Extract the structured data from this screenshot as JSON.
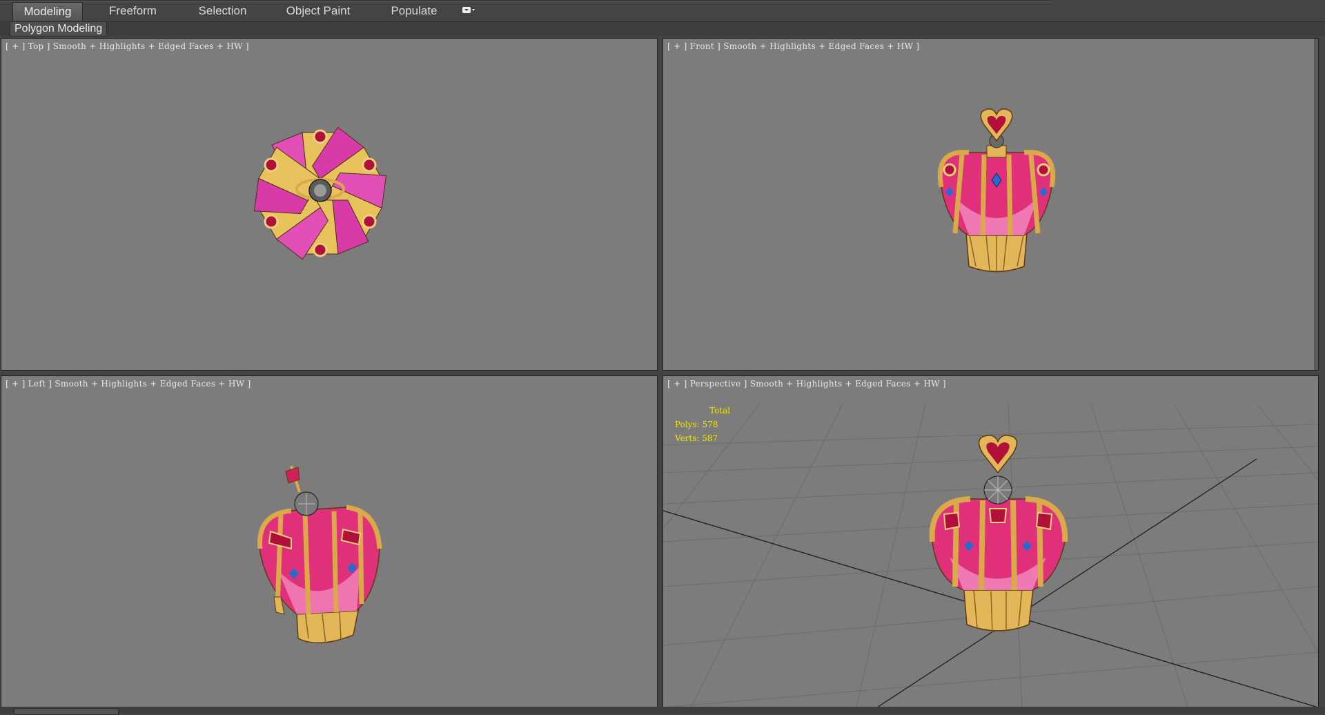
{
  "ribbon": {
    "tabs": [
      {
        "label": "Modeling",
        "active": true
      },
      {
        "label": "Freeform",
        "active": false
      },
      {
        "label": "Selection",
        "active": false
      },
      {
        "label": "Object Paint",
        "active": false
      },
      {
        "label": "Populate",
        "active": false
      }
    ],
    "panel_label": "Polygon Modeling",
    "menu_icon": "ribbon-options-dropdown-icon"
  },
  "viewports": {
    "top": {
      "label": "[ + ] Top ] Smooth + Highlights + Edged Faces + HW ]"
    },
    "front": {
      "label": "[ + ] Front ] Smooth + Highlights + Edged Faces + HW ]"
    },
    "left": {
      "label": "[ + ] Left ] Smooth + Highlights + Edged Faces + HW ]"
    },
    "perspective": {
      "label": "[ + ] Perspective ] Smooth + Highlights + Edged Faces + HW ]",
      "stats": {
        "title": "Total",
        "polys": "Polys: 578",
        "verts": "Verts: 587"
      }
    }
  },
  "colors": {
    "viewport_bg": "#7c7c7c",
    "gold": "#d9a94a",
    "gold_dark": "#8a6420",
    "pink": "#e0307a",
    "pink_light": "#f38cc0",
    "stats_yellow": "#f2e400",
    "grid_line": "#6c6c6c"
  }
}
